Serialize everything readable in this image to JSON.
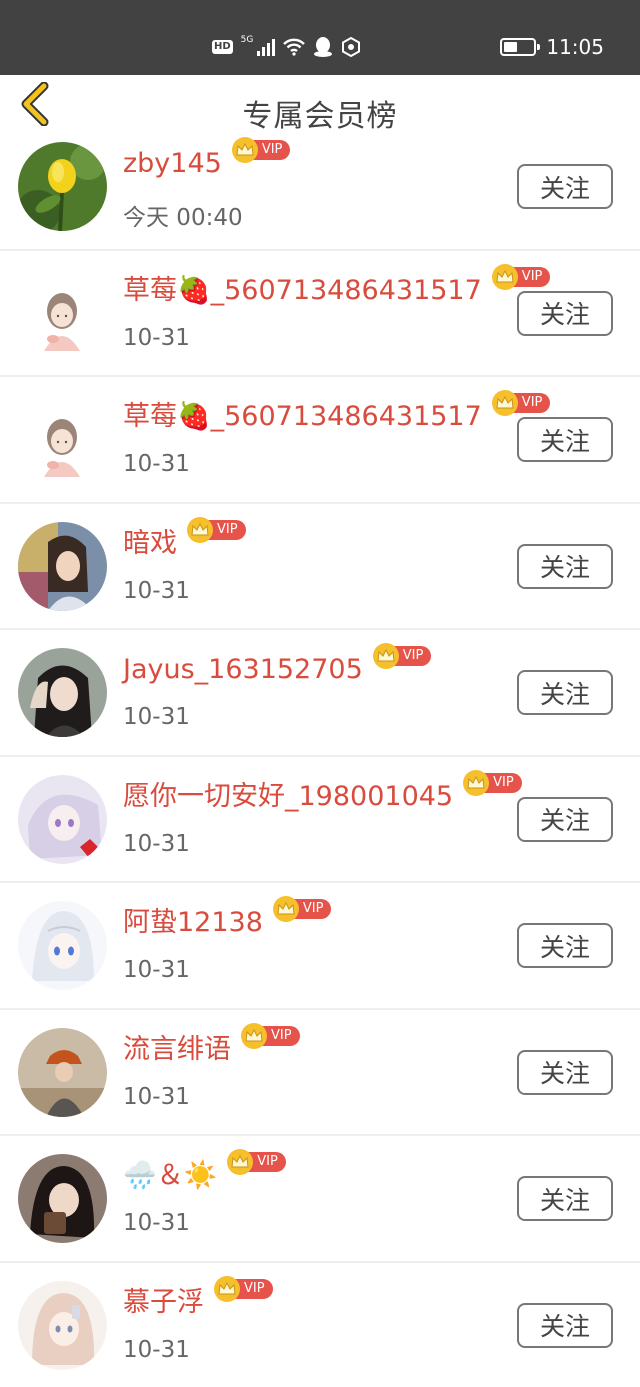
{
  "status_bar": {
    "network_badge": "HD",
    "signal_label": "5G",
    "time": "11:05",
    "battery_level": 0.45,
    "icons": [
      "hd-icon",
      "signal-icon",
      "wifi-icon",
      "qq-icon",
      "location-icon",
      "battery-icon"
    ]
  },
  "header": {
    "back_icon": "chevron-left-icon",
    "title": "专属会员榜"
  },
  "vip_badge": {
    "label": "VIP",
    "crown_icon": "crown-icon",
    "colors": {
      "crown": "#f6c02c",
      "pill": "#e5534a"
    }
  },
  "colors": {
    "name": "#d94b3d",
    "title": "#444444",
    "back": "#f4c21f",
    "status_bar": "#424242"
  },
  "members": [
    {
      "name": "zby145",
      "time": "今天 00:40",
      "follow_label": "关注",
      "avatar": "yellow-rose-avatar"
    },
    {
      "name": "草莓🍓_560713486431517",
      "time": "10-31",
      "follow_label": "关注",
      "avatar": "girl-drawing-avatar"
    },
    {
      "name": "草莓🍓_560713486431517",
      "time": "10-31",
      "follow_label": "关注",
      "avatar": "girl-drawing-avatar"
    },
    {
      "name": "暗戏",
      "time": "10-31",
      "follow_label": "关注",
      "avatar": "anime-boy-avatar"
    },
    {
      "name": "Jayus_163152705",
      "time": "10-31",
      "follow_label": "关注",
      "avatar": "selfie-girl-avatar"
    },
    {
      "name": "愿你一切安好_198001045",
      "time": "10-31",
      "follow_label": "关注",
      "avatar": "anime-girl-avatar"
    },
    {
      "name": "阿蛰12138",
      "time": "10-31",
      "follow_label": "关注",
      "avatar": "white-hair-anime-avatar"
    },
    {
      "name": "流言绯语",
      "time": "10-31",
      "follow_label": "关注",
      "avatar": "orange-hat-avatar"
    },
    {
      "name": "🌧️＆☀️",
      "time": "10-31",
      "follow_label": "关注",
      "avatar": "girl-photo-avatar"
    },
    {
      "name": "慕子浮",
      "time": "10-31",
      "follow_label": "关注",
      "avatar": "sketch-girl-avatar"
    }
  ]
}
